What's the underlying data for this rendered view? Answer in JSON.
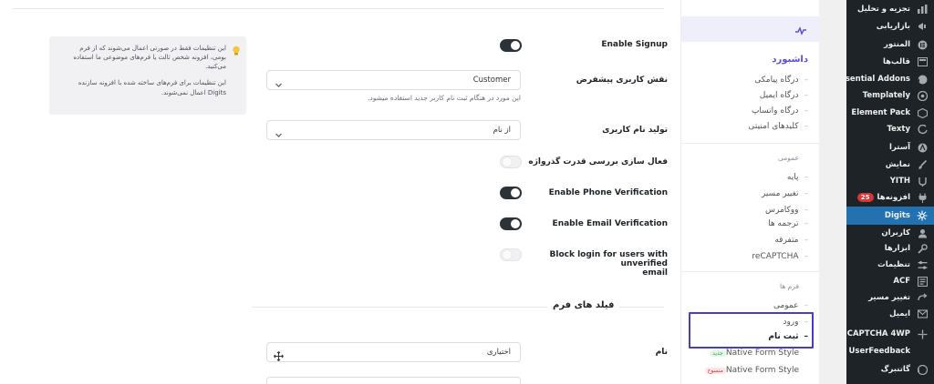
{
  "wp_sidebar": {
    "items": [
      {
        "label": "تجزیه و تحلیل",
        "icon": "bar-chart-icon"
      },
      {
        "label": "بازاریابی",
        "icon": "megaphone-icon"
      },
      {
        "label": "المنتور",
        "icon": "elementor-icon"
      },
      {
        "label": "قالب‌ها",
        "icon": "templates-icon"
      },
      {
        "label": "Essential Addons",
        "icon": "essential-addons-icon"
      },
      {
        "label": "Templately",
        "icon": "templately-icon"
      },
      {
        "label": "Element Pack",
        "icon": "element-pack-icon"
      },
      {
        "label": "Texty",
        "icon": "texty-icon"
      },
      {
        "label": "آسترا",
        "icon": "astra-icon"
      },
      {
        "label": "نمایش",
        "icon": "brush-icon"
      },
      {
        "label": "YITH",
        "icon": "yith-icon"
      },
      {
        "label": "افزونه‌ها",
        "icon": "plugin-icon",
        "badge": "25"
      },
      {
        "label": "Digits",
        "icon": "digits-icon",
        "active": true
      },
      {
        "label": "کاربران",
        "icon": "users-icon"
      },
      {
        "label": "ابزارها",
        "icon": "tools-icon"
      },
      {
        "label": "تنظیمات",
        "icon": "settings-icon"
      },
      {
        "label": "ACF",
        "icon": "acf-icon"
      },
      {
        "label": "تغییر مسیر",
        "icon": "redirect-icon"
      },
      {
        "label": "ایمیل",
        "icon": "email-icon"
      },
      {
        "label": "CAPTCHA 4WP",
        "icon": "captcha-icon"
      },
      {
        "label": "UserFeedback",
        "icon": "feedback-icon"
      },
      {
        "label": "گاتنبرگ",
        "icon": "gutenberg-icon"
      }
    ]
  },
  "digits_nav": {
    "dashboard": "داشبورد",
    "gateway_links": [
      "درگاه پیامکی",
      "درگاه ایمیل",
      "درگاه واتساپ",
      "کلیدهای امنیتی"
    ],
    "general_section": "عمومی",
    "general_links": [
      "پایه",
      "تغییر مسیر",
      "ووکامرس",
      "ترجمه ها",
      "متفرقه",
      "reCAPTCHA"
    ],
    "forms_section": "فرم ها",
    "forms_links": [
      "عمومی",
      "ورود",
      "ثبت نام"
    ],
    "native_links": [
      {
        "label": "Native Form Style",
        "pill": "جدید",
        "pill_type": "new"
      },
      {
        "label": "Native Form Style",
        "pill": "منسوخ",
        "pill_type": "old"
      }
    ]
  },
  "settings": {
    "enable_signup": {
      "label": "Enable Signup",
      "enabled": true
    },
    "default_role": {
      "label": "نقش کاربری پیشفرض",
      "value": "Customer",
      "hint": "این مورد در هنگام ثبت نام کاربر جدید استفاده میشود."
    },
    "username_gen": {
      "label": "تولید نام کاربری",
      "value": "از نام"
    },
    "password_strength": {
      "label": "فعال سازی بررسی قدرت گذرواژه",
      "enabled": false
    },
    "phone_verification": {
      "label": "Enable Phone Verification",
      "enabled": true
    },
    "email_verification": {
      "label": "Enable Email Verification",
      "enabled": true
    },
    "block_unverified": {
      "label_line1": "Block login for users with unverified",
      "label_line2": "email",
      "enabled": false
    }
  },
  "info_box": {
    "p1": "این تنظیمات فقط در صورتی اعمال می‌شوند که از فرم بومی، افزونه شخص ثالث یا فرم‌های موضوعی ما استفاده می‌کنید.",
    "p2": "این تنظیمات برای فرم‌های ساخته شده با افزونه سازنده Digits اعمال نمی‌شوند."
  },
  "form_fields": {
    "title": "فیلد های فرم",
    "name_label": "نام",
    "name_value": "اختیاری"
  },
  "colors": {
    "accent": "#5b4bd9",
    "wp_active": "#2271b1",
    "highlight": "#4b3dbf"
  }
}
